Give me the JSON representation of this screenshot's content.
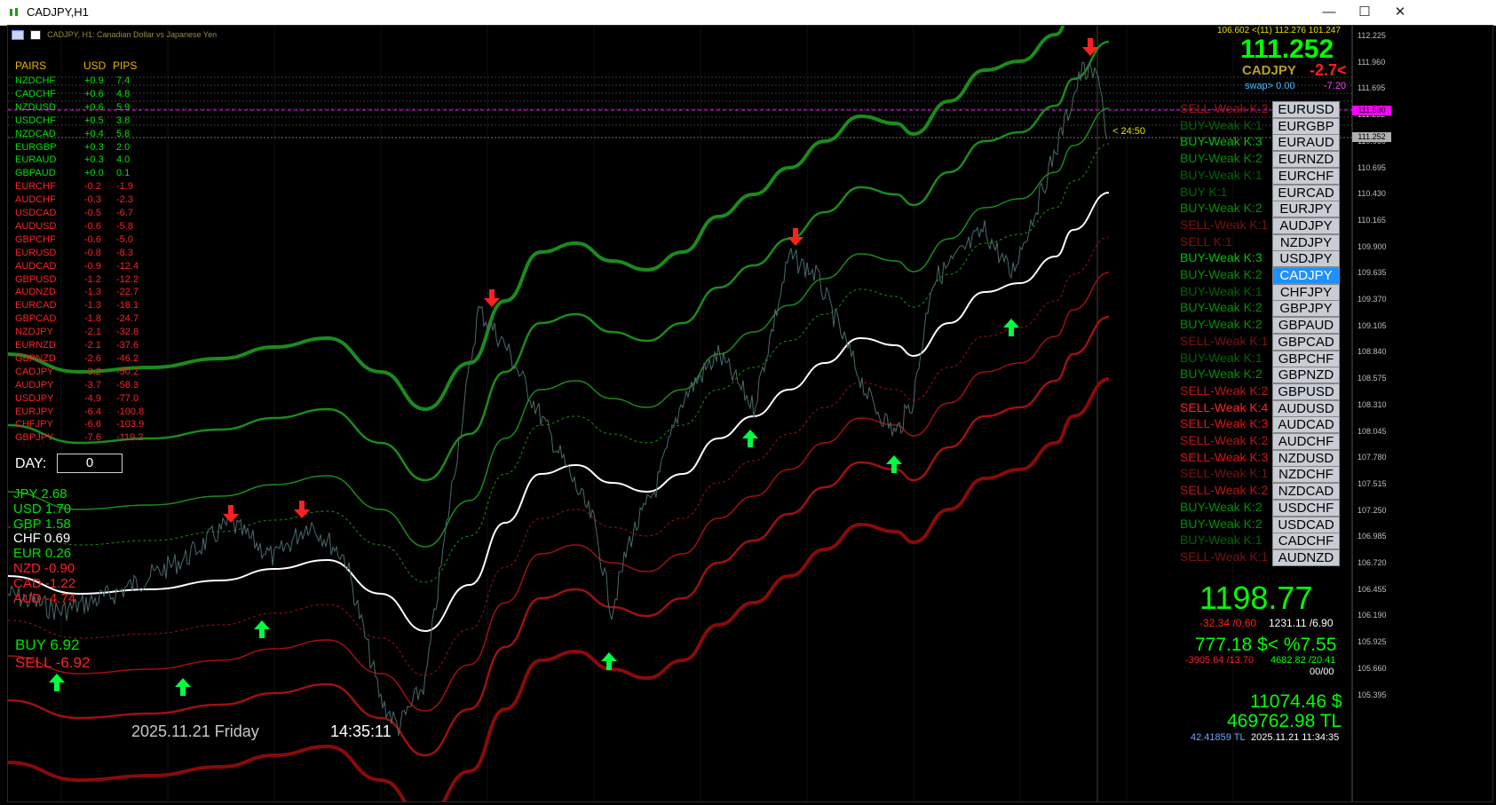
{
  "window": {
    "title": "CADJPY,H1"
  },
  "chart_header": {
    "symbol_line": "CADJPY, H1:  Canadian Dollar vs Japanese Yen"
  },
  "pairs_table": {
    "headers": [
      "PAIRS",
      "USD",
      "PIPS"
    ],
    "rows": [
      {
        "pair": "NZDCHF",
        "usd": "+0.9",
        "pips": "7.4",
        "color": "#00e000"
      },
      {
        "pair": "CADCHF",
        "usd": "+0.6",
        "pips": "4.8",
        "color": "#00e000"
      },
      {
        "pair": "NZDUSD",
        "usd": "+0.6",
        "pips": "5.9",
        "color": "#00e000"
      },
      {
        "pair": "USDCHF",
        "usd": "+0.5",
        "pips": "3.8",
        "color": "#00e000"
      },
      {
        "pair": "NZDCAD",
        "usd": "+0.4",
        "pips": "5.8",
        "color": "#00e000"
      },
      {
        "pair": "EURGBP",
        "usd": "+0.3",
        "pips": "2.0",
        "color": "#00e000"
      },
      {
        "pair": "EURAUD",
        "usd": "+0.3",
        "pips": "4.0",
        "color": "#00e000"
      },
      {
        "pair": "GBPAUD",
        "usd": "+0.0",
        "pips": "0.1",
        "color": "#00e000"
      },
      {
        "pair": "EURCHF",
        "usd": "-0.2",
        "pips": "-1.9",
        "color": "#ff2020"
      },
      {
        "pair": "AUDCHF",
        "usd": "-0.3",
        "pips": "-2.3",
        "color": "#ff2020"
      },
      {
        "pair": "USDCAD",
        "usd": "-0.5",
        "pips": "-6.7",
        "color": "#ff2020"
      },
      {
        "pair": "AUDUSD",
        "usd": "-0.6",
        "pips": "-5.8",
        "color": "#ff2020"
      },
      {
        "pair": "GBPCHF",
        "usd": "-0.6",
        "pips": "-5.0",
        "color": "#ff2020"
      },
      {
        "pair": "EURUSD",
        "usd": "-0.8",
        "pips": "-8.3",
        "color": "#ff2020"
      },
      {
        "pair": "AUDCAD",
        "usd": "-0.9",
        "pips": "-12.4",
        "color": "#ff2020"
      },
      {
        "pair": "GBPUSD",
        "usd": "-1.2",
        "pips": "-12.2",
        "color": "#ff2020"
      },
      {
        "pair": "AUDNZD",
        "usd": "-1.3",
        "pips": "-22.7",
        "color": "#ff2020"
      },
      {
        "pair": "EURCAD",
        "usd": "-1.3",
        "pips": "-18.1",
        "color": "#ff2020"
      },
      {
        "pair": "GBPCAD",
        "usd": "-1.8",
        "pips": "-24.7",
        "color": "#ff2020"
      },
      {
        "pair": "NZDJPY",
        "usd": "-2.1",
        "pips": "-32.8",
        "color": "#ff2020"
      },
      {
        "pair": "EURNZD",
        "usd": "-2.1",
        "pips": "-37.6",
        "color": "#ff2020"
      },
      {
        "pair": "GBPNZD",
        "usd": "-2.6",
        "pips": "-46.2",
        "color": "#ff2020"
      },
      {
        "pair": "CADJPY",
        "usd": "-3.2",
        "pips": "-50.2",
        "color": "#ff2020"
      },
      {
        "pair": "AUDJPY",
        "usd": "-3.7",
        "pips": "-58.3",
        "color": "#ff2020"
      },
      {
        "pair": "USDJPY",
        "usd": "-4.9",
        "pips": "-77.0",
        "color": "#ff2020"
      },
      {
        "pair": "EURJPY",
        "usd": "-6.4",
        "pips": "-100.8",
        "color": "#ff2020"
      },
      {
        "pair": "CHFJPY",
        "usd": "-6.6",
        "pips": "-103.9",
        "color": "#ff2020"
      },
      {
        "pair": "GBPJPY",
        "usd": "-7.6",
        "pips": "-119.2",
        "color": "#ff2020"
      }
    ]
  },
  "day": {
    "label": "DAY:",
    "value": "0"
  },
  "currency_strength": [
    {
      "name": "JPY",
      "value": "2.68",
      "color": "#00e000"
    },
    {
      "name": "USD",
      "value": "1.70",
      "color": "#00e000"
    },
    {
      "name": "GBP",
      "value": "1.58",
      "color": "#00e000"
    },
    {
      "name": "CHF",
      "value": "0.69",
      "color": "#ffffff"
    },
    {
      "name": "EUR",
      "value": "0.26",
      "color": "#00e000"
    },
    {
      "name": "NZD",
      "value": "-0.90",
      "color": "#ff2020"
    },
    {
      "name": "CAD",
      "value": "-1.22",
      "color": "#ff2020"
    },
    {
      "name": "AUD",
      "value": "-4.74",
      "color": "#ff2020"
    }
  ],
  "buy_sell": {
    "buy": "BUY  6.92",
    "sell": "SELL -6.92"
  },
  "footer": {
    "date": "2025.11.21  Friday",
    "time": "14:35:11"
  },
  "price_panel": {
    "top_line": "106.602 <(11) 112.276 101.247",
    "price": "111.252",
    "symbol": "CADJPY",
    "change": "-2.7<",
    "swap": "swap> 0.00",
    "swap2": "-7.20",
    "countdown": "< 24:50"
  },
  "signals": [
    {
      "label": "SELL-Weak K:2",
      "pair": "EURUSD",
      "color": "#a01010",
      "active": false
    },
    {
      "label": "BUY-Weak K:1",
      "pair": "EURGBP",
      "color": "#006400",
      "active": false
    },
    {
      "label": "BUY-Weak K:3",
      "pair": "EURAUD",
      "color": "#00c000",
      "active": false
    },
    {
      "label": "BUY-Weak K:2",
      "pair": "EURNZD",
      "color": "#009000",
      "active": false
    },
    {
      "label": "BUY-Weak K:1",
      "pair": "EURCHF",
      "color": "#006400",
      "active": false
    },
    {
      "label": "BUY K:1",
      "pair": "EURCAD",
      "color": "#006400",
      "active": false
    },
    {
      "label": "BUY-Weak K:2",
      "pair": "EURJPY",
      "color": "#009000",
      "active": false
    },
    {
      "label": "SELL-Weak K:1",
      "pair": "AUDJPY",
      "color": "#7a1010",
      "active": false
    },
    {
      "label": "SELL K:1",
      "pair": "NZDJPY",
      "color": "#7a1010",
      "active": false
    },
    {
      "label": "BUY-Weak K:3",
      "pair": "USDJPY",
      "color": "#00c000",
      "active": false
    },
    {
      "label": "BUY-Weak K:2",
      "pair": "CADJPY",
      "color": "#009000",
      "active": true
    },
    {
      "label": "BUY-Weak K:1",
      "pair": "CHFJPY",
      "color": "#006400",
      "active": false
    },
    {
      "label": "BUY-Weak K:2",
      "pair": "GBPJPY",
      "color": "#009000",
      "active": false
    },
    {
      "label": "BUY-Weak K:2",
      "pair": "GBPAUD",
      "color": "#009000",
      "active": false
    },
    {
      "label": "SELL-Weak K:1",
      "pair": "GBPCAD",
      "color": "#7a1010",
      "active": false
    },
    {
      "label": "BUY-Weak K:1",
      "pair": "GBPCHF",
      "color": "#006400",
      "active": false
    },
    {
      "label": "BUY-Weak K:2",
      "pair": "GBPNZD",
      "color": "#009000",
      "active": false
    },
    {
      "label": "SELL-Weak K:2",
      "pair": "GBPUSD",
      "color": "#c01010",
      "active": false
    },
    {
      "label": "SELL-Weak K:4",
      "pair": "AUDUSD",
      "color": "#ff2020",
      "active": false
    },
    {
      "label": "SELL-Weak K:3",
      "pair": "AUDCAD",
      "color": "#e01010",
      "active": false
    },
    {
      "label": "SELL-Weak K:2",
      "pair": "AUDCHF",
      "color": "#c01010",
      "active": false
    },
    {
      "label": "SELL-Weak K:3",
      "pair": "NZDUSD",
      "color": "#e01010",
      "active": false
    },
    {
      "label": "SELL-Weak K:1",
      "pair": "NZDCHF",
      "color": "#7a1010",
      "active": false
    },
    {
      "label": "SELL-Weak K:2",
      "pair": "NZDCAD",
      "color": "#c01010",
      "active": false
    },
    {
      "label": "BUY-Weak K:2",
      "pair": "USDCHF",
      "color": "#009000",
      "active": false
    },
    {
      "label": "BUY-Weak K:2",
      "pair": "USDCAD",
      "color": "#009000",
      "active": false
    },
    {
      "label": "BUY-Weak K:1",
      "pair": "CADCHF",
      "color": "#006400",
      "active": false
    },
    {
      "label": "SELL-Weak K:1",
      "pair": "AUDNZD",
      "color": "#7a1010",
      "active": false
    }
  ],
  "account": {
    "equity": "1198.77",
    "line2a": "-32.34 /0.60",
    "line2b": "1231.11 /6.90",
    "line3": "777.18 $< %7.55",
    "line4a": "-3905.64 /13.70",
    "line4b": "4682.82 /20.41",
    "line5": "00/00",
    "usd": "11074.46 $",
    "tl": "469762.98 TL",
    "rate": "42.41859 TL",
    "server_time": "2025.11.21 11:34:35"
  },
  "price_axis": {
    "labels": [
      "112.225",
      "111.960",
      "111.695",
      "111.252",
      "110.960",
      "110.695",
      "110.430",
      "110.165",
      "109.900",
      "109.635",
      "109.370",
      "109.105",
      "108.840",
      "108.575",
      "108.310",
      "108.045",
      "107.780",
      "107.515",
      "107.250",
      "106.985",
      "106.720",
      "106.455",
      "106.190",
      "105.925",
      "105.660",
      "105.395"
    ],
    "current_tag": "111.252",
    "magenta_tag": "111.530"
  },
  "colors": {
    "bull_band": "#1a8c1a",
    "bear_band": "#a01010",
    "mid_line": "#ffffff",
    "price": "#2f4f4f",
    "buy_arrow": "#00ff40",
    "sell_arrow": "#ff2020"
  }
}
